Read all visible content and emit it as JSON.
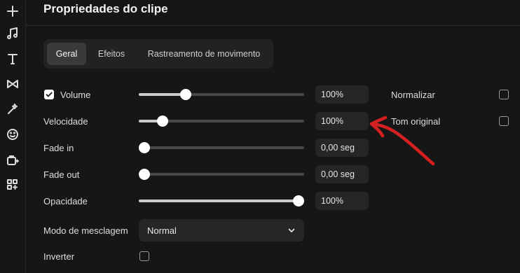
{
  "header": {
    "title": "Propriedades do clipe"
  },
  "tabs": [
    {
      "label": "Geral",
      "active": true
    },
    {
      "label": "Efeitos",
      "active": false
    },
    {
      "label": "Rastreamento de movimento",
      "active": false
    }
  ],
  "sidebar": {
    "icons": [
      "add-icon",
      "music-icon",
      "text-icon",
      "transition-icon",
      "effects-icon",
      "sticker-icon",
      "plugin-icon",
      "apps-icon"
    ]
  },
  "rows": {
    "volume": {
      "label": "Volume",
      "checked": true,
      "value": "100%",
      "level": 0.27
    },
    "speed": {
      "label": "Velocidade",
      "value": "100%",
      "level": 0.12
    },
    "fade_in": {
      "label": "Fade in",
      "value": "0,00 seg",
      "level": 0.0
    },
    "fade_out": {
      "label": "Fade out",
      "value": "0,00 seg",
      "level": 0.0
    },
    "opacity": {
      "label": "Opacidade",
      "value": "100%",
      "level": 1.0
    },
    "blend": {
      "label": "Modo de mesclagem",
      "value": "Normal"
    },
    "invert": {
      "label": "Inverter",
      "checked": false
    }
  },
  "options": {
    "normalize": {
      "label": "Normalizar",
      "checked": false
    },
    "original_pitch": {
      "label": "Tom original",
      "checked": false
    }
  },
  "colors": {
    "background": "#161616",
    "annotation": "#d42020"
  }
}
